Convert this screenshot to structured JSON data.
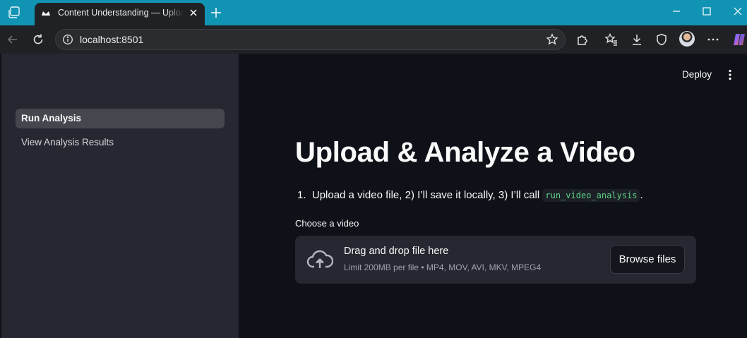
{
  "browser": {
    "tab_title": "Content Understanding — Upload & Analyze a Video",
    "address": "localhost:8501"
  },
  "sidebar": {
    "items": [
      {
        "label": "Run Analysis",
        "active": true
      },
      {
        "label": "View Analysis Results",
        "active": false
      }
    ]
  },
  "header": {
    "deploy_label": "Deploy"
  },
  "main": {
    "title": "Upload & Analyze a Video",
    "list_item_number": "1.",
    "list_item_text": "Upload a video file, 2) I’ll save it locally, 3) I’ll call",
    "list_item_code": "run_video_analysis",
    "list_item_suffix": ".",
    "uploader": {
      "label": "Choose a video",
      "title": "Drag and drop file here",
      "subtitle": "Limit 200MB per file • MP4, MOV, AVI, MKV, MPEG4",
      "button_label": "Browse files"
    }
  },
  "colors": {
    "titlebar": "#1193b4",
    "sidebar_bg": "#262730",
    "main_bg": "#0e1117",
    "code_text": "#5fd08a"
  },
  "icons": [
    "workspaces-icon",
    "streamlit-favicon-icon",
    "close-tab-icon",
    "new-tab-icon",
    "minimize-icon",
    "maximize-icon",
    "close-window-icon",
    "back-icon",
    "reload-icon",
    "site-info-icon",
    "favorite-star-icon",
    "extensions-icon",
    "favorites-icon",
    "downloads-icon",
    "browser-essentials-icon",
    "profile-avatar",
    "more-icon",
    "copilot-icon",
    "kebab-menu-icon",
    "upload-cloud-icon"
  ]
}
